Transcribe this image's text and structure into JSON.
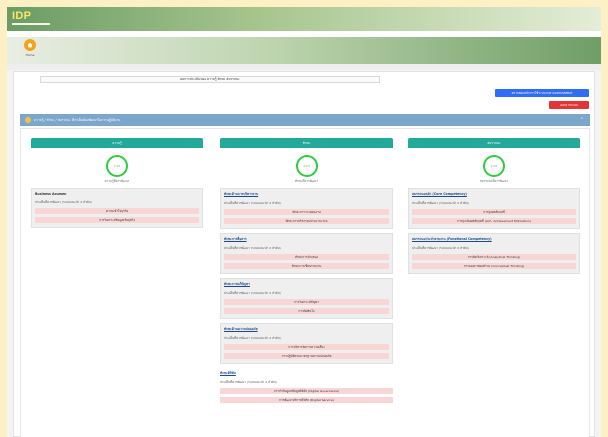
{
  "app": {
    "logo": "IDP"
  },
  "nav": {
    "home_label": "Home"
  },
  "main": {
    "employee_title": "ผลการประเมินของ ความรู้ ทักษะ สมรรถนะ",
    "btn_assessment": "ตรวจสอบหลักการใช้ระบบ IDP ASSESSMENT",
    "btn_logout": "ออกจากระบบ"
  },
  "accordion": {
    "title": "ความรู้ / ทักษะ / สมรรถนะ ที่จำเป็นต้องพัฒนาในการปฏิบัติงาน"
  },
  "columns": [
    {
      "header": "ความรู้",
      "gauge_value": "2.00",
      "gauge_caption": "ความรู้ที่ควรพัฒนา",
      "sections": [
        {
          "title": "Business Acumen",
          "subtitle": "ประเด็นที่ควรพัฒนา (ระบบแนะนำ 2 ลำดับ)",
          "items": [
            "ความเข้าใจธุรกิจ",
            "การวิเคราะห์ข้อมูลเชิงธุรกิจ"
          ]
        }
      ]
    },
    {
      "header": "ทักษะ",
      "gauge_value": "4.00",
      "gauge_caption": "ทักษะที่ควรพัฒนา",
      "sections": [
        {
          "title": "ทักษะด้านการบริหารงาน",
          "subtitle": "ประเด็นที่ควรพัฒนา (ระบบแนะนำ 2 ลำดับ)",
          "items": [
            "ทักษะการวางแผนงาน",
            "ทักษะการบริหารงบประมาณ ICS"
          ]
        },
        {
          "title": "ทักษะการสื่อสาร",
          "subtitle": "ประเด็นที่ควรพัฒนา (ระบบแนะนำ 2 ลำดับ)",
          "items": [
            "ทักษะการนำเสนอ",
            "ทักษะการเขียนรายงาน"
          ]
        },
        {
          "title": "ทักษะการแก้ปัญหา",
          "subtitle": "ประเด็นที่ควรพัฒนา (ระบบแนะนำ 2 ลำดับ)",
          "items": [
            "การวิเคราะห์ปัญหา",
            "การตัดสินใจ"
          ]
        },
        {
          "title": "ทักษะด้านความปลอดภัย",
          "subtitle": "ประเด็นที่ควรพัฒนา (ระบบแนะนำ 2 ลำดับ)",
          "items": [
            "การบริหารจัดการความเสี่ยง",
            "การปฏิบัติตามมาตรฐานความปลอดภัย"
          ]
        },
        {
          "title": "ทักษะดิจิทัล",
          "subtitle": "ประเด็นที่ควรพัฒนา (ระบบแนะนำ 2 ลำดับ)",
          "items": [
            "การกำกับดูแลข้อมูลดิจิทัล (Digital Governance)",
            "การพัฒนาบริการดิจิทัล (Digital Service)"
          ],
          "plain": true
        }
      ]
    },
    {
      "header": "สมรรถนะ",
      "gauge_value": "2.00",
      "gauge_caption": "สมรรถนะที่ควรพัฒนา",
      "sections": [
        {
          "title": "สมรรถนะหลัก (Core Competency)",
          "subtitle": "ประเด็นที่ควรพัฒนา (ระบบแนะนำ 2 ลำดับ)",
          "items": [
            "การมุ่งผลสัมฤทธิ์",
            "การมุ่งเน้นผลสัมฤทธิ์ (Ach. Achievement Motivation)"
          ]
        },
        {
          "title": "สมรรถนะประจำสายงาน (Functional Competency)",
          "subtitle": "ประเด็นที่ควรพัฒนา (ระบบแนะนำ 2 ลำดับ)",
          "items": [
            "การคิดวิเคราะห์ (Analytical Thinking)",
            "การมองภาพองค์รวม (Conceptual Thinking)"
          ]
        }
      ]
    }
  ],
  "colors": {
    "teal": "#22a999",
    "blue": "#2f6df5",
    "red": "#e23636",
    "pink": "#f9d6d6",
    "gauge": "#2ecc40"
  }
}
